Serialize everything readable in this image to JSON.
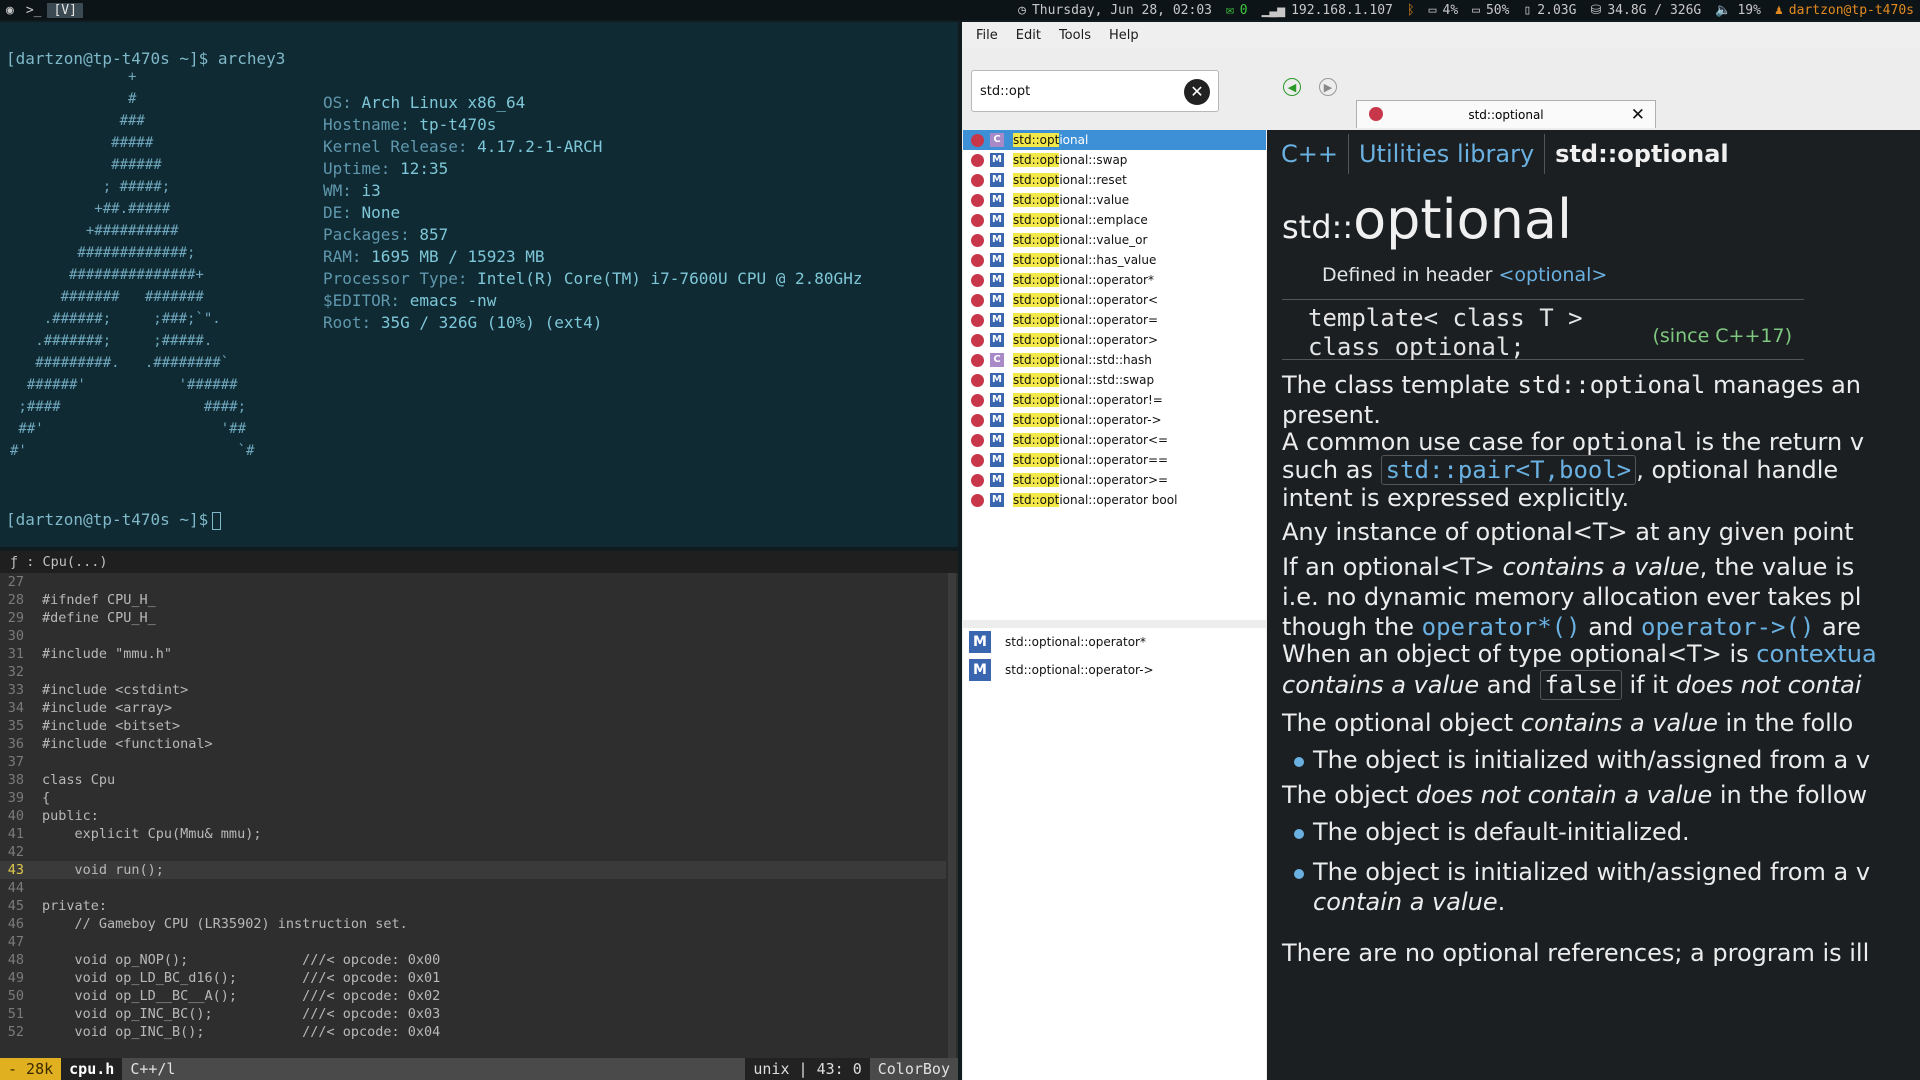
{
  "topbar": {
    "workspaces": [
      "[V]"
    ],
    "datetime": "Thursday, Jun 28, 02:03",
    "mail_count": "0",
    "ip": "192.168.1.107",
    "battery1": "4%",
    "battery2": "50%",
    "memory": "2.03G",
    "disk": "34.8G / 326G",
    "volume": "19%",
    "user": "dartzon@tp-t470s"
  },
  "terminal": {
    "prompt1": "[dartzon@tp-t470s ~]$ archey3",
    "prompt2": "[dartzon@tp-t470s ~]$",
    "logo": "              +\n              #\n             ###\n            #####\n            ######\n           ; #####;\n          +##.#####\n         +##########\n        #############;\n       ###############+\n      #######   #######\n    .######;     ;###;`\".\n   .#######;     ;#####.\n   #########.   .########`\n  ######'           '######\n ;####                 ####;\n ##'                     '##\n#'                         `#",
    "info": [
      {
        "k": "OS:",
        "v": "Arch Linux x86_64"
      },
      {
        "k": "Hostname:",
        "v": "tp-t470s"
      },
      {
        "k": "Kernel Release:",
        "v": "4.17.2-1-ARCH"
      },
      {
        "k": "Uptime:",
        "v": "12:35"
      },
      {
        "k": "WM:",
        "v": "i3"
      },
      {
        "k": "DE:",
        "v": "None"
      },
      {
        "k": "Packages:",
        "v": "857"
      },
      {
        "k": "RAM:",
        "v": "1695 MB / 15923 MB"
      },
      {
        "k": "Processor Type:",
        "v": "Intel(R) Core(TM) i7-7600U CPU @ 2.80GHz"
      },
      {
        "k": "$EDITOR:",
        "v": "emacs -nw"
      },
      {
        "k": "Root:",
        "v": "35G / 326G (10%) (ext4)"
      }
    ]
  },
  "emacs": {
    "header": "ƒ : Cpu(...)",
    "lines": [
      {
        "n": "27",
        "c": ""
      },
      {
        "n": "28",
        "c": "#ifndef CPU_H_"
      },
      {
        "n": "29",
        "c": "#define CPU_H_"
      },
      {
        "n": "30",
        "c": ""
      },
      {
        "n": "31",
        "c": "#include \"mmu.h\""
      },
      {
        "n": "32",
        "c": ""
      },
      {
        "n": "33",
        "c": "#include <cstdint>"
      },
      {
        "n": "34",
        "c": "#include <array>"
      },
      {
        "n": "35",
        "c": "#include <bitset>"
      },
      {
        "n": "36",
        "c": "#include <functional>"
      },
      {
        "n": "37",
        "c": ""
      },
      {
        "n": "38",
        "c": "class Cpu"
      },
      {
        "n": "39",
        "c": "{"
      },
      {
        "n": "40",
        "c": "public:"
      },
      {
        "n": "41",
        "c": "    explicit Cpu(Mmu& mmu);"
      },
      {
        "n": "42",
        "c": ""
      },
      {
        "n": "43",
        "c": "    void run();"
      },
      {
        "n": "44",
        "c": ""
      },
      {
        "n": "45",
        "c": "private:"
      },
      {
        "n": "46",
        "c": "    // Gameboy CPU (LR35902) instruction set."
      },
      {
        "n": "47",
        "c": ""
      },
      {
        "n": "48",
        "c": "    void op_NOP();              ///< opcode: 0x00"
      },
      {
        "n": "49",
        "c": "    void op_LD_BC_d16();        ///< opcode: 0x01"
      },
      {
        "n": "50",
        "c": "    void op_LD__BC__A();        ///< opcode: 0x02"
      },
      {
        "n": "51",
        "c": "    void op_INC_BC();           ///< opcode: 0x03"
      },
      {
        "n": "52",
        "c": "    void op_INC_B();            ///< opcode: 0x04"
      }
    ],
    "current_line": "43",
    "modeline": {
      "modified": "- 28k",
      "filename": "cpu.h",
      "mode": "C++/l",
      "encoding": "unix | 43: 0",
      "project": "ColorBoy"
    }
  },
  "zeal": {
    "menu": [
      "File",
      "Edit",
      "Tools",
      "Help"
    ],
    "search_value": "std::opt",
    "tab_title": "std::optional",
    "results": [
      {
        "kind": "C",
        "pre": "std::opt",
        "post": "ional",
        "selected": true
      },
      {
        "kind": "M",
        "pre": "std::opt",
        "post": "ional::swap"
      },
      {
        "kind": "M",
        "pre": "std::opt",
        "post": "ional::reset"
      },
      {
        "kind": "M",
        "pre": "std::opt",
        "post": "ional::value"
      },
      {
        "kind": "M",
        "pre": "std::opt",
        "post": "ional::emplace"
      },
      {
        "kind": "M",
        "pre": "std::opt",
        "post": "ional::value_or"
      },
      {
        "kind": "M",
        "pre": "std::opt",
        "post": "ional::has_value"
      },
      {
        "kind": "M",
        "pre": "std::opt",
        "post": "ional::operator*"
      },
      {
        "kind": "M",
        "pre": "std::opt",
        "post": "ional::operator<"
      },
      {
        "kind": "M",
        "pre": "std::opt",
        "post": "ional::operator="
      },
      {
        "kind": "M",
        "pre": "std::opt",
        "post": "ional::operator>"
      },
      {
        "kind": "C",
        "pre": "std::opt",
        "post": "ional::std::hash"
      },
      {
        "kind": "M",
        "pre": "std::opt",
        "post": "ional::std::swap"
      },
      {
        "kind": "M",
        "pre": "std::opt",
        "post": "ional::operator!="
      },
      {
        "kind": "M",
        "pre": "std::opt",
        "post": "ional::operator->"
      },
      {
        "kind": "M",
        "pre": "std::opt",
        "post": "ional::operator<="
      },
      {
        "kind": "M",
        "pre": "std::opt",
        "post": "ional::operator=="
      },
      {
        "kind": "M",
        "pre": "std::opt",
        "post": "ional::operator>="
      },
      {
        "kind": "M",
        "pre": "std::opt",
        "post": "ional::operator bool"
      }
    ],
    "toc": [
      {
        "kind": "M",
        "label": "std::optional::operator*"
      },
      {
        "kind": "M",
        "label": "std::optional::operator->"
      }
    ]
  },
  "doc": {
    "crumbs": [
      "C++",
      "Utilities library",
      "std::optional"
    ],
    "title_ns": "std::",
    "title_name": "optional",
    "defined_in": "Defined in header",
    "header_link": "<optional>",
    "tmpl_line1": "template< class T >",
    "tmpl_line2": "class optional;",
    "since": "(since C++17)",
    "p1a": "The class template",
    "p1b": "std::optional",
    "p1c": "manages an",
    "p1d": "present.",
    "p2a": "A common use case for",
    "p2b": "optional",
    "p2c": "is the return v",
    "p2d": "such as",
    "p2e": "std::pair<T,bool>",
    "p2f": ", optional handle",
    "p2g": "intent is expressed explicitly.",
    "p3": "Any instance of optional<T> at any given point",
    "p4a": "If an optional<T>",
    "p4b": "contains a value",
    "p4c": ", the value is",
    "p4d": "i.e. no dynamic memory allocation ever takes pl",
    "p4e": "though the",
    "p4f": "operator*()",
    "p4g": "and",
    "p4h": "operator->()",
    "p4i": "are",
    "p5a": "When an object of type optional<T> is",
    "p5b": "contextua",
    "p5c": "contains a value",
    "p5d": "and",
    "p5e": "false",
    "p5f": "if it",
    "p5g": "does not contai",
    "p6a": "The optional object",
    "p6b": "contains a value",
    "p6c": "in the follo",
    "b1": "The object is initialized with/assigned from a v",
    "p7a": "The object",
    "p7b": "does not contain a value",
    "p7c": "in the follow",
    "b2": "The object is default-initialized.",
    "b3a": "The object is initialized with/assigned from a v",
    "b3b": "contain a value",
    "b3c": ".",
    "p8": "There are no optional references; a program is ill"
  }
}
